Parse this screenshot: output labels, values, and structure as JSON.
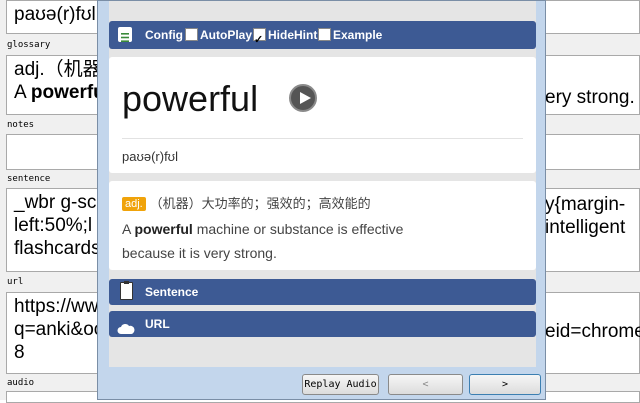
{
  "note": {
    "field_text_value": "paʊə(r)fʊl",
    "glossary_label": "glossary",
    "glossary_line1": "adj.（机器",
    "glossary_line2_pre": "A ",
    "glossary_line2_bold": "powerfu",
    "glossary_right": "ery strong.",
    "notes_label": "notes",
    "sentence_label": "sentence",
    "sentence_line1": "_wbr g-sc",
    "sentence_line1_right": "y{margin-",
    "sentence_line2": "left:50%;l",
    "sentence_line2_right": "intelligent",
    "sentence_line3": "flashcards",
    "url_label": "url",
    "url_line1": "https://ww",
    "url_line2": "q=anki&oc",
    "url_line2_right": "eid=chrome",
    "url_line3": "8",
    "audio_label": "audio"
  },
  "popup": {
    "toolbar": {
      "config_label": "Config",
      "autoplay_label": "AutoPlay",
      "autoplay_checked": false,
      "hidehint_label": "HideHint",
      "hidehint_checked": true,
      "example_label": "Example",
      "example_checked": false
    },
    "word": "powerful",
    "phonetic": "paʊə(r)fʊl",
    "definition": {
      "pos_badge": "adj.",
      "chinese": "（机器）大功率的；强效的；高效能的",
      "english_pre": "A ",
      "english_bold": "powerful",
      "english_post": " machine or substance is effective because it is very strong."
    },
    "sections": {
      "sentence_label": "Sentence",
      "url_label": "URL"
    },
    "bottom": {
      "replay_label": "Replay Audio",
      "prev_label": "<",
      "next_label": ">"
    }
  },
  "colors": {
    "bar_blue": "#3d5a94",
    "badge_orange": "#f0a30a",
    "play_dark": "#555555"
  }
}
